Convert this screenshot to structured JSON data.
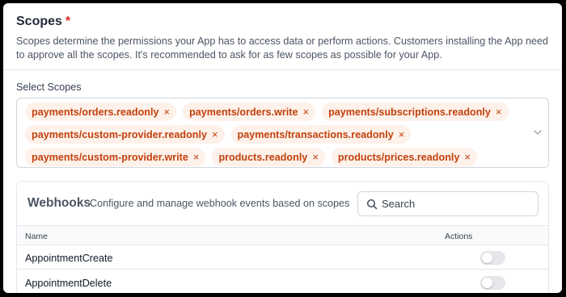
{
  "scopes": {
    "title": "Scopes",
    "required_marker": "*",
    "description": "Scopes determine the permissions your App has to access data or perform actions. Customers installing the App need to approve all the scopes. It's recommended to ask for as few scopes as possible for your App.",
    "select_label": "Select Scopes",
    "selected": [
      {
        "label": "payments/orders.readonly"
      },
      {
        "label": "payments/orders.write"
      },
      {
        "label": "payments/subscriptions.readonly"
      },
      {
        "label": "payments/custom-provider.readonly"
      },
      {
        "label": "payments/transactions.readonly"
      },
      {
        "label": "payments/custom-provider.write"
      },
      {
        "label": "products.readonly"
      },
      {
        "label": "products/prices.readonly"
      }
    ],
    "remove_glyph": "×"
  },
  "webhooks": {
    "title": "Webhooks",
    "subtitle": "Configure and manage webhook events based on scopes",
    "search_placeholder": "Search",
    "columns": {
      "name": "Name",
      "actions": "Actions"
    },
    "rows": [
      {
        "name": "AppointmentCreate",
        "enabled": false
      },
      {
        "name": "AppointmentDelete",
        "enabled": false
      }
    ]
  },
  "colors": {
    "accent": "#c2410c",
    "tag_bg": "#fdf1ea",
    "required": "#dc2626"
  }
}
